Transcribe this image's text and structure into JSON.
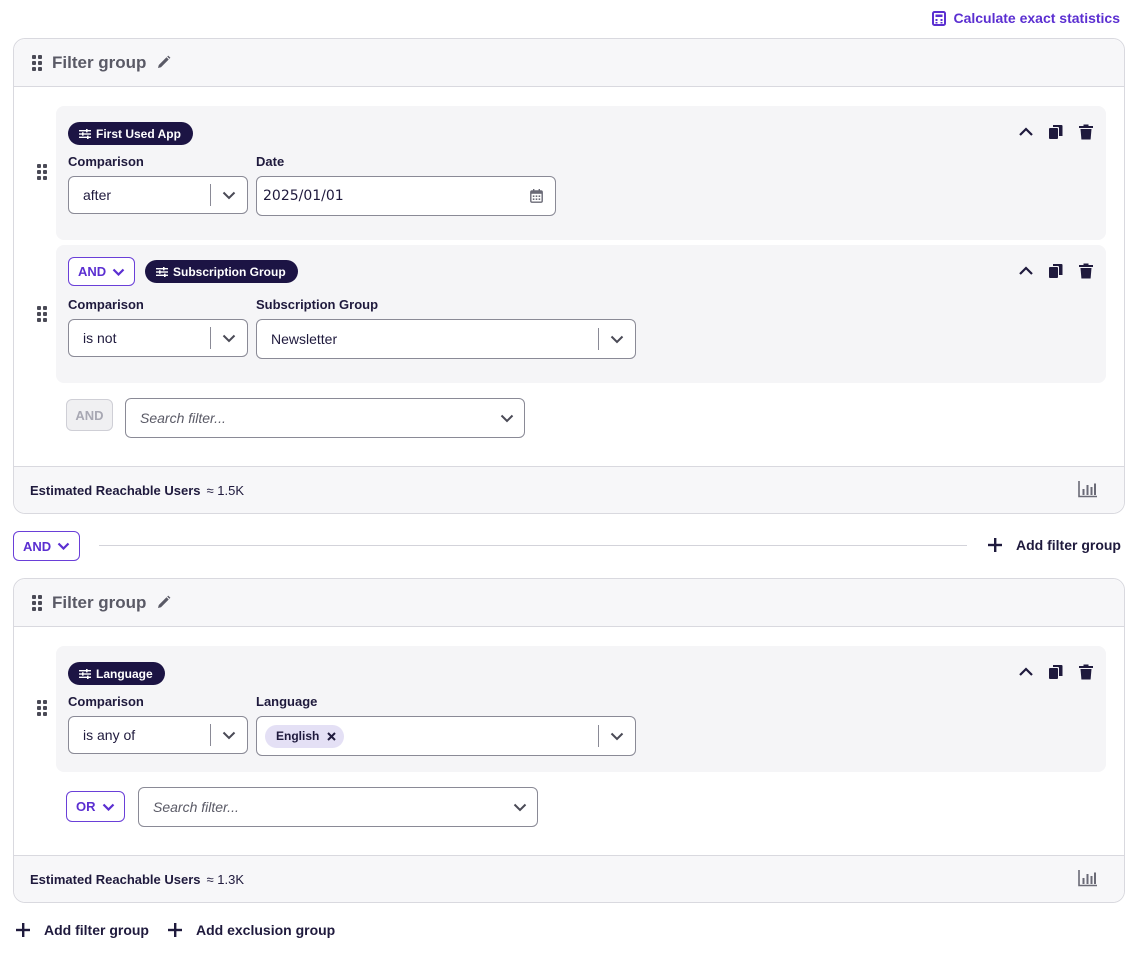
{
  "header": {
    "calc_label": "Calculate exact statistics"
  },
  "groups": [
    {
      "title": "Filter group",
      "filters": [
        {
          "name": "First Used App",
          "comparison_label": "Comparison",
          "comparison_value": "after",
          "field_label": "Date",
          "field_value": "2025/01/01"
        },
        {
          "conjunction": "AND",
          "name": "Subscription Group",
          "comparison_label": "Comparison",
          "comparison_value": "is not",
          "field_label": "Subscription Group",
          "field_value": "Newsletter"
        }
      ],
      "add_conjunction": "AND",
      "search_placeholder": "Search filter...",
      "estimate_label": "Estimated Reachable Users",
      "estimate_value": "≈ 1.5K"
    },
    {
      "title": "Filter group",
      "filters": [
        {
          "name": "Language",
          "comparison_label": "Comparison",
          "comparison_value": "is any of",
          "field_label": "Language",
          "tags": [
            "English"
          ]
        }
      ],
      "add_conjunction": "OR",
      "search_placeholder": "Search filter...",
      "estimate_label": "Estimated Reachable Users",
      "estimate_value": "≈ 1.3K"
    }
  ],
  "between_groups": {
    "conjunction": "AND",
    "add_group_label": "Add filter group"
  },
  "bottom": {
    "add_group_label": "Add filter group",
    "add_exclusion_label": "Add exclusion group"
  }
}
